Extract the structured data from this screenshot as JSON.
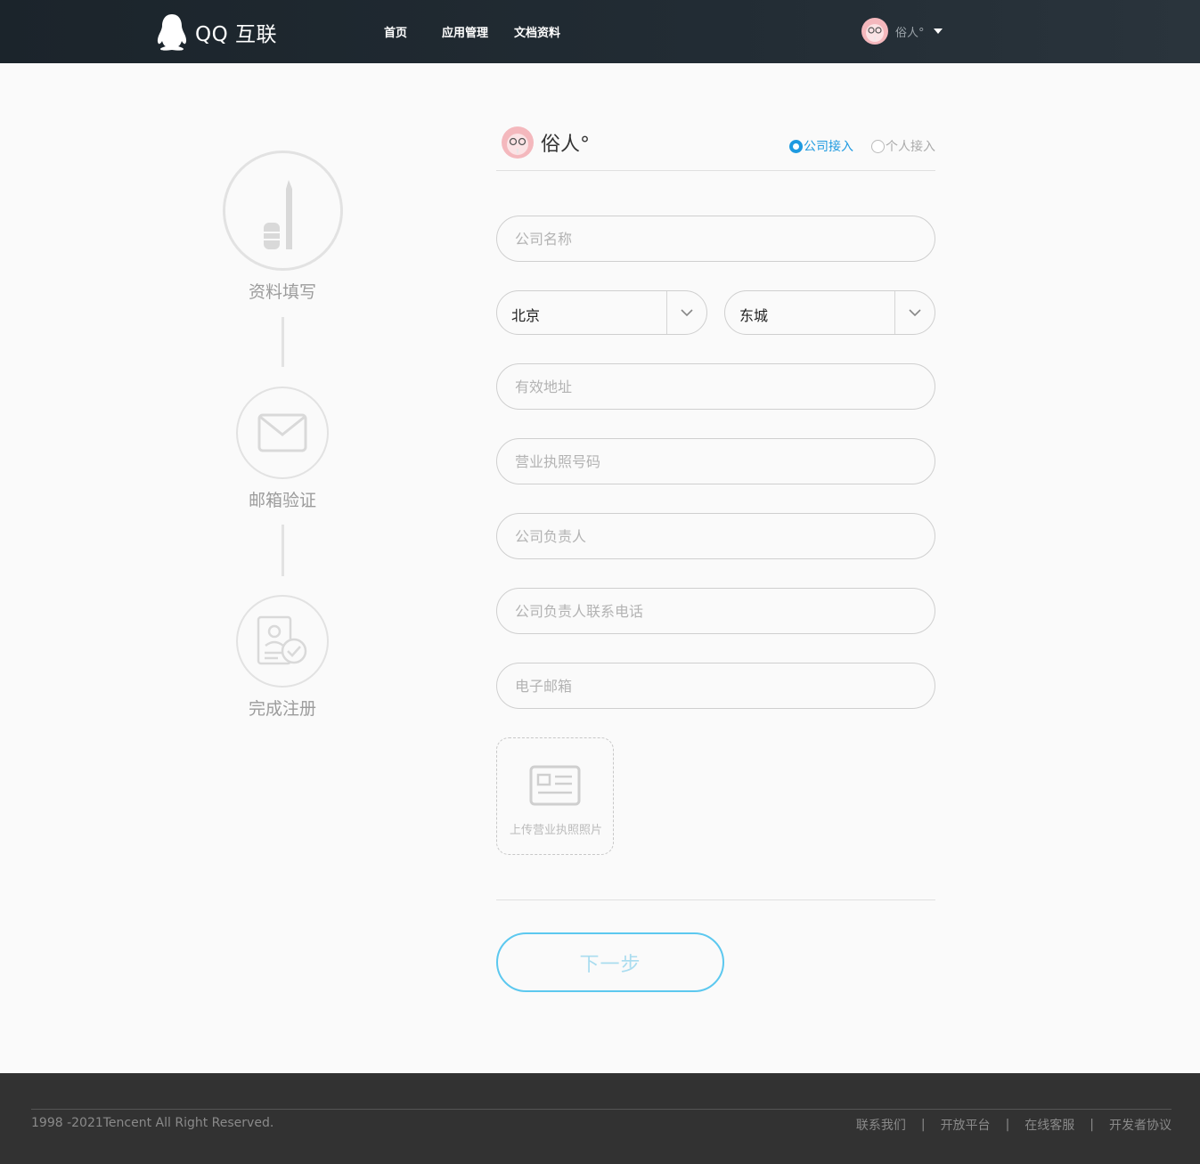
{
  "header": {
    "logo_text": "QQ 互联",
    "nav": [
      {
        "label": "首页"
      },
      {
        "label": "应用管理"
      },
      {
        "label": "文档资料"
      }
    ],
    "user_name": "俗人°"
  },
  "steps": [
    {
      "label": "资料填写"
    },
    {
      "label": "邮箱验证"
    },
    {
      "label": "完成注册"
    }
  ],
  "form": {
    "user_name": "俗人°",
    "access_types": [
      {
        "label": "公司接入",
        "selected": true
      },
      {
        "label": "个人接入",
        "selected": false
      }
    ],
    "company_name": {
      "placeholder": "公司名称",
      "value": ""
    },
    "province": {
      "value": "北京"
    },
    "district": {
      "value": "东城"
    },
    "address": {
      "placeholder": "有效地址",
      "value": ""
    },
    "license_number": {
      "placeholder": "营业执照号码",
      "value": ""
    },
    "principal": {
      "placeholder": "公司负责人",
      "value": ""
    },
    "principal_phone": {
      "placeholder": "公司负责人联系电话",
      "value": ""
    },
    "email": {
      "placeholder": "电子邮箱",
      "value": ""
    },
    "upload_label": "上传营业执照照片",
    "next_label": "下一步"
  },
  "footer": {
    "copyright": "1998 -2021Tencent All Right Reserved.",
    "links": [
      {
        "label": "联系我们"
      },
      {
        "label": "开放平台"
      },
      {
        "label": "在线客服"
      },
      {
        "label": "开发者协议"
      }
    ],
    "separator": "|"
  },
  "colors": {
    "header_bg": "#1b242b",
    "accent_blue": "#1e9ae0",
    "button_border": "#5cc8ef",
    "footer_bg": "#323232"
  }
}
